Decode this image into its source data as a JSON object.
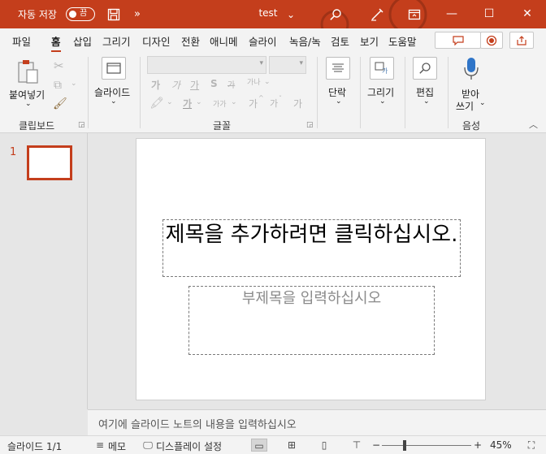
{
  "titlebar": {
    "autosave_label": "자동 저장",
    "toggle_label": "끔",
    "save_icon": "save-icon",
    "more_icon": "»",
    "doc_title": "test",
    "search_icon": "search-icon",
    "designer_icon": "pen-icon",
    "ribbon_display_icon": "ribbon-display-icon",
    "minimize": "—",
    "maximize": "☐",
    "close": "✕",
    "colors": {
      "bar": "#c43e1c",
      "text": "#ffffff"
    }
  },
  "tabs": [
    {
      "label": "파일"
    },
    {
      "label": "홈"
    },
    {
      "label": "삽입"
    },
    {
      "label": "그리기"
    },
    {
      "label": "디자인"
    },
    {
      "label": "전환"
    },
    {
      "label": "애니메"
    },
    {
      "label": "슬라이"
    },
    {
      "label": "녹음/녹"
    },
    {
      "label": "검토"
    },
    {
      "label": "보기"
    },
    {
      "label": "도움말"
    }
  ],
  "ribbon": {
    "clipboard": {
      "paste_label": "붙여넣기",
      "group_label": "클립보드"
    },
    "slides": {
      "new_slide_label": "슬라이드"
    },
    "font": {
      "bold": "가",
      "italic": "가",
      "underline": "가",
      "shadow": "S",
      "strike": "가",
      "spacing": "가나",
      "size_small": "가가",
      "case": "가",
      "grow": "가",
      "shrink": "가",
      "clear": "가",
      "group_label": "글꼴"
    },
    "paragraph": {
      "label": "단락"
    },
    "drawing": {
      "label": "그리기"
    },
    "editing": {
      "label": "편집"
    },
    "voice": {
      "dictate_line1": "받아",
      "dictate_line2": "쓰기",
      "group_label": "음성"
    }
  },
  "thumbnails": [
    {
      "number": "1"
    }
  ],
  "slide": {
    "title_placeholder": "제목을 추가하려면 클릭하십시오.",
    "subtitle_placeholder": "부제목을 입력하십시오"
  },
  "notes": {
    "placeholder": "여기에 슬라이드 노트의 내용을 입력하십시오"
  },
  "statusbar": {
    "slide_counter": "슬라이드 1/1",
    "notes_label": "메모",
    "display_settings_label": "디스플레이 설정",
    "zoom_minus": "−",
    "zoom_plus": "+",
    "zoom_level": "45%",
    "zoom_fraction": 0.45
  }
}
